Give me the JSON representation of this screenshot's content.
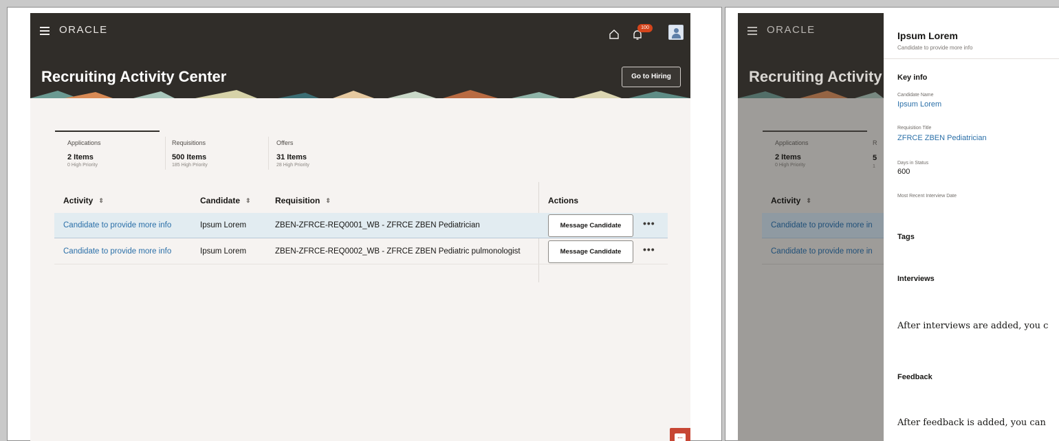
{
  "left": {
    "logo": "ORACLE",
    "notification_count": "100",
    "page_title": "Recruiting Activity Center",
    "go_to_hiring": "Go to Hiring",
    "metrics": [
      {
        "label": "Applications",
        "value": "2 Items",
        "sub": "0 High Priority"
      },
      {
        "label": "Requisitions",
        "value": "500 Items",
        "sub": "185 High Priority"
      },
      {
        "label": "Offers",
        "value": "31 Items",
        "sub": "28 High Priority"
      }
    ],
    "table": {
      "headers": {
        "activity": "Activity",
        "candidate": "Candidate",
        "requisition": "Requisition",
        "actions": "Actions"
      },
      "rows": [
        {
          "activity": "Candidate to provide more info",
          "candidate": "Ipsum Lorem",
          "requisition": "ZBEN-ZFRCE-REQ0001_WB - ZFRCE ZBEN Pediatrician",
          "action": "Message Candidate",
          "more": "•••"
        },
        {
          "activity": "Candidate to provide more info",
          "candidate": "Ipsum Lorem",
          "requisition": "ZBEN-ZFRCE-REQ0002_WB - ZFRCE ZBEN Pediatric pulmonologist",
          "action": "Message Candidate",
          "more": "•••"
        }
      ]
    }
  },
  "right": {
    "logo": "ORACLE",
    "page_title_partial": "Recruiting Activity",
    "metric": {
      "label": "Applications",
      "value": "2 Items",
      "sub": "0 High Priority",
      "next_label_initial": "R",
      "next_value_initial": "5",
      "next_sub_initial": "1"
    },
    "table": {
      "activity_header": "Activity",
      "row1_activity": "Candidate to provide more in",
      "row2_activity": "Candidate to provide more in"
    },
    "panel": {
      "title": "Ipsum Lorem",
      "subtitle": "Candidate to provide more info",
      "key_info_heading": "Key info",
      "candidate_name_label": "Candidate Name",
      "candidate_name": "Ipsum Lorem",
      "requisition_title_label": "Requisition Title",
      "requisition_title": "ZFRCE ZBEN Pediatrician",
      "days_in_status_label": "Days in Status",
      "days_in_status": "600",
      "interview_date_label": "Most Recent Interview Date",
      "tags_heading": "Tags",
      "interviews_heading": "Interviews",
      "interviews_empty": "After interviews are added, you c",
      "feedback_heading": "Feedback",
      "feedback_empty": "After feedback is added, you can"
    }
  },
  "colors": {
    "header": "#302d29",
    "link": "#2a6fa8",
    "selected_row": "#e2ecf1",
    "accent": "#c74634"
  },
  "icons": [
    "menu-icon",
    "home-icon",
    "bell-icon",
    "avatar",
    "sort-icon",
    "more-icon",
    "chat-icon"
  ]
}
